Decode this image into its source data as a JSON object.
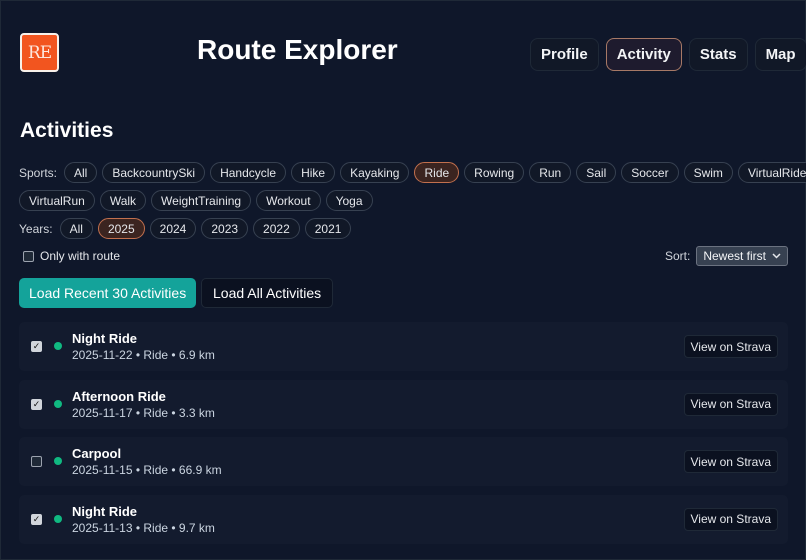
{
  "app": {
    "logo_text": "RE",
    "title": "Route Explorer"
  },
  "nav": [
    {
      "label": "Profile",
      "active": false
    },
    {
      "label": "Activity",
      "active": true
    },
    {
      "label": "Stats",
      "active": false
    },
    {
      "label": "Map",
      "active": false
    }
  ],
  "page": {
    "heading": "Activities"
  },
  "filters": {
    "sports_label": "Sports:",
    "sports_row1": [
      "All",
      "BackcountrySki",
      "Handcycle",
      "Hike",
      "Kayaking",
      "Ride",
      "Rowing",
      "Run",
      "Sail",
      "Soccer",
      "Swim",
      "VirtualRide"
    ],
    "sports_row2": [
      "VirtualRun",
      "Walk",
      "WeightTraining",
      "Workout",
      "Yoga"
    ],
    "selected_sport": "Ride",
    "years_label": "Years:",
    "years": [
      "All",
      "2025",
      "2024",
      "2023",
      "2022",
      "2021"
    ],
    "selected_year": "2025",
    "only_route_label": "Only with route",
    "only_route_checked": false
  },
  "sort": {
    "label": "Sort:",
    "value": "Newest first"
  },
  "actions": {
    "load_recent": "Load Recent 30 Activities",
    "load_all": "Load All Activities"
  },
  "activities": [
    {
      "name": "Night Ride",
      "meta": "2025-11-22 • Ride • 6.9 km",
      "checked": true,
      "link": "View on Strava"
    },
    {
      "name": "Afternoon Ride",
      "meta": "2025-11-17 • Ride • 3.3 km",
      "checked": true,
      "link": "View on Strava"
    },
    {
      "name": "Carpool",
      "meta": "2025-11-15 • Ride • 66.9 km",
      "checked": false,
      "link": "View on Strava"
    },
    {
      "name": "Night Ride",
      "meta": "2025-11-13 • Ride • 9.7 km",
      "checked": true,
      "link": "View on Strava"
    }
  ],
  "colors": {
    "accent": "#14a39a",
    "brand": "#f2551f",
    "status_dot": "#10b981",
    "selected_chip_border": "#c2704e"
  }
}
